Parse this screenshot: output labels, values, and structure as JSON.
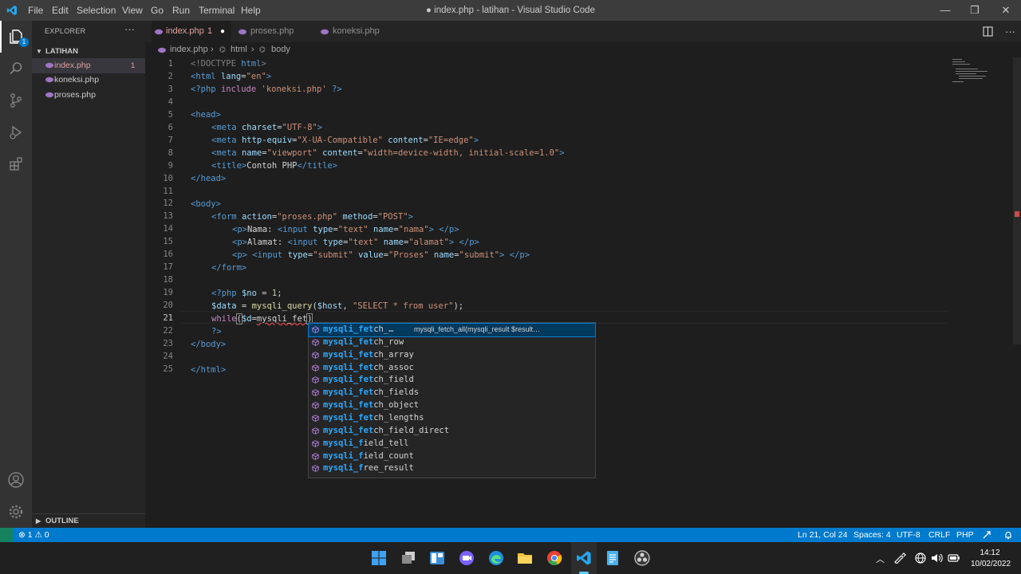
{
  "titlebar": {
    "menu": [
      "File",
      "Edit",
      "Selection",
      "View",
      "Go",
      "Run",
      "Terminal",
      "Help"
    ],
    "title": "● index.php - latihan - Visual Studio Code",
    "minimize": "—",
    "maximize": "❐",
    "close": "✕"
  },
  "sidebar": {
    "header": "EXPLORER",
    "more": "···",
    "folder": "LATIHAN",
    "files": [
      {
        "name": "index.php",
        "badge": "1"
      },
      {
        "name": "koneksi.php",
        "badge": ""
      },
      {
        "name": "proses.php",
        "badge": ""
      }
    ],
    "outline": "OUTLINE"
  },
  "tabs": [
    {
      "name": "index.php",
      "badge": "1",
      "modified": "●"
    },
    {
      "name": "proses.php"
    },
    {
      "name": "koneksi.php"
    }
  ],
  "breadcrumb": {
    "file": "index.php",
    "sep1": "›",
    "html": "html",
    "sep2": "›",
    "body": "body"
  },
  "editor": {
    "line_numbers": [
      "1",
      "2",
      "3",
      "4",
      "5",
      "6",
      "7",
      "8",
      "9",
      "10",
      "11",
      "12",
      "13",
      "14",
      "15",
      "16",
      "17",
      "18",
      "19",
      "20",
      "21",
      "22",
      "23",
      "24",
      "25"
    ],
    "lines": {
      "l1": [
        "<!DOCTYPE ",
        "html",
        ">"
      ],
      "l2": [
        "<html ",
        "lang",
        "=",
        "\"en\"",
        ">"
      ],
      "l3": [
        "<?php ",
        "include ",
        "'koneksi.php'",
        " ?>"
      ],
      "l5": [
        "<head>"
      ],
      "l6": [
        "<meta ",
        "charset",
        "=",
        "\"UTF-8\"",
        ">"
      ],
      "l7": [
        "<meta ",
        "http-equiv",
        "=",
        "\"X-UA-Compatible\"",
        " content",
        "=",
        "\"IE=edge\"",
        ">"
      ],
      "l8": [
        "<meta ",
        "name",
        "=",
        "\"viewport\"",
        " content",
        "=",
        "\"width=device-width, initial-scale=1.0\"",
        ">"
      ],
      "l9": [
        "<title>",
        "Contoh PHP",
        "</title>"
      ],
      "l10": [
        "</head>"
      ],
      "l12": [
        "<body>"
      ],
      "l13": [
        "<form ",
        "action",
        "=",
        "\"proses.php\"",
        " method",
        "=",
        "\"POST\"",
        ">"
      ],
      "l14": [
        "<p>",
        "Nama: ",
        "<input ",
        "type",
        "=",
        "\"text\"",
        " name",
        "=",
        "\"nama\"",
        "> ",
        "</p>"
      ],
      "l15": [
        "<p>",
        "Alamat: ",
        "<input ",
        "type",
        "=",
        "\"text\"",
        " name",
        "=",
        "\"alamat\"",
        "> ",
        "</p>"
      ],
      "l16": [
        "<p> ",
        "<input ",
        "type",
        "=",
        "\"submit\"",
        " value",
        "=",
        "\"Proses\"",
        " name",
        "=",
        "\"submit\"",
        "> ",
        "</p>"
      ],
      "l17": [
        "</form>"
      ],
      "l19": [
        "<?php ",
        "$no",
        " = ",
        "1",
        ";"
      ],
      "l20": [
        "$data",
        " = ",
        "mysqli_query",
        "(",
        "$host",
        ", ",
        "\"SELECT * from user\"",
        ");"
      ],
      "l21": [
        "while",
        "(",
        "$d",
        "=",
        "mysqli_fet",
        ")"
      ],
      "l22": [
        "?>"
      ],
      "l23": [
        "</body>"
      ],
      "l25": [
        "</html>"
      ]
    }
  },
  "suggest": {
    "items": [
      {
        "hl": "mysqli_fet",
        "rest": "ch_…",
        "detail": "mysqli_fetch_all(mysqli_result $result…"
      },
      {
        "hl": "mysqli_fet",
        "rest": "ch_row"
      },
      {
        "hl": "mysqli_fet",
        "rest": "ch_array"
      },
      {
        "hl": "mysqli_fet",
        "rest": "ch_assoc"
      },
      {
        "hl": "mysqli_fet",
        "rest": "ch_field"
      },
      {
        "hl": "mysqli_fet",
        "rest": "ch_fields"
      },
      {
        "hl": "mysqli_fet",
        "rest": "ch_object"
      },
      {
        "hl": "mysqli_fet",
        "rest": "ch_lengths"
      },
      {
        "hl": "mysqli_fet",
        "rest": "ch_field_direct"
      },
      {
        "hl": "mysqli_f",
        "rest": "ield_tell"
      },
      {
        "hl": "mysqli_f",
        "rest": "ield_count"
      },
      {
        "hl": "mysqli_f",
        "rest": "ree_result"
      }
    ]
  },
  "status": {
    "errors": "⊗ 1 ⚠ 0",
    "position": "Ln 21, Col 24",
    "spaces": "Spaces: 4",
    "encoding": "UTF-8",
    "eol": "CRLF",
    "language": "PHP"
  },
  "taskbar": {
    "time": "14:12",
    "date": "10/02/2022"
  },
  "colors": {
    "accent": "#007acc",
    "php_icon": "#a074c4",
    "error": "#f14c4c"
  }
}
